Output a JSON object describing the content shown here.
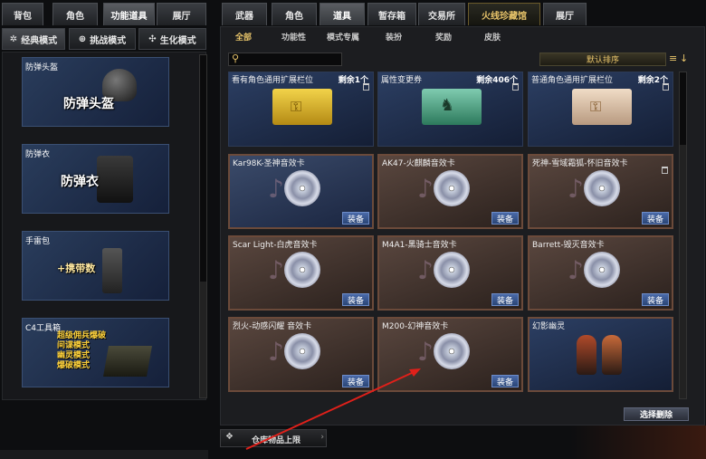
{
  "left_tabs": [
    {
      "label": "背包"
    },
    {
      "label": "角色"
    },
    {
      "label": "功能道具"
    },
    {
      "label": "展厅"
    }
  ],
  "modes": [
    {
      "label": "经典模式"
    },
    {
      "label": "挑战模式"
    },
    {
      "label": "生化模式"
    }
  ],
  "left_items": [
    {
      "label": "防弹头盔",
      "big": "防弹头盔"
    },
    {
      "label": "防弹衣",
      "big": "防弹衣"
    },
    {
      "label": "手雷包",
      "big": "+携带数"
    },
    {
      "label": "C4工具箱",
      "lines": [
        "超级佣兵爆破",
        "间谍模式",
        "幽灵模式",
        "爆破模式"
      ]
    }
  ],
  "right_tabs": [
    {
      "label": "武器"
    },
    {
      "label": "角色"
    },
    {
      "label": "道具"
    },
    {
      "label": "暂存箱"
    },
    {
      "label": "交易所"
    },
    {
      "label": "火线珍藏馆"
    },
    {
      "label": "展厅"
    }
  ],
  "sub_tabs": [
    {
      "label": "全部"
    },
    {
      "label": "功能性"
    },
    {
      "label": "模式专属"
    },
    {
      "label": "装扮"
    },
    {
      "label": "奖励"
    },
    {
      "label": "皮肤"
    }
  ],
  "sort": {
    "label": "默认排序"
  },
  "equip_label": "装备",
  "items": [
    {
      "name": "看有角色通用扩展栏位",
      "remain": "剩余1个",
      "type": "ticket-gold"
    },
    {
      "name": "属性变更券",
      "remain": "剩余406个",
      "type": "ticket-green"
    },
    {
      "name": "普通角色通用扩展栏位",
      "remain": "剩余2个",
      "type": "ticket-beige"
    },
    {
      "name": "Kar98K-圣神音效卡",
      "type": "disc",
      "highlight": true
    },
    {
      "name": "AK47-火麒麟音效卡",
      "type": "disc"
    },
    {
      "name": "死神-雪域霜狐-怀旧音效卡",
      "type": "disc"
    },
    {
      "name": "Scar Light-白虎音效卡",
      "type": "disc"
    },
    {
      "name": "M4A1-黑骑士音效卡",
      "type": "disc"
    },
    {
      "name": "Barrett-毁灭音效卡",
      "type": "disc"
    },
    {
      "name": "烈火-动感闪耀 音效卡",
      "type": "disc"
    },
    {
      "name": "M200-幻神音效卡",
      "type": "disc"
    },
    {
      "name": "幻影幽灵",
      "type": "char"
    }
  ],
  "select_delete": "选择删除",
  "warehouse": "仓库物品上限",
  "colors": {
    "accent": "#e8c46a",
    "equip_blue": "#3a5a98",
    "card_border": "#6b4a3a",
    "arrow": "#e0201a"
  }
}
